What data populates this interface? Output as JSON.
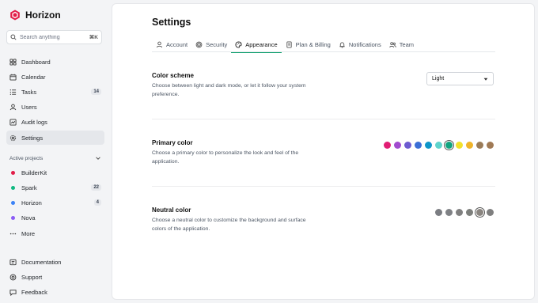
{
  "brand": {
    "name": "Horizon",
    "color": "#e11d48"
  },
  "search": {
    "placeholder": "Search anything",
    "shortcut": "⌘K"
  },
  "sidebar": {
    "items": [
      {
        "label": "Dashboard",
        "icon": "dashboard-icon"
      },
      {
        "label": "Calendar",
        "icon": "calendar-icon"
      },
      {
        "label": "Tasks",
        "icon": "tasks-icon",
        "badge": "14"
      },
      {
        "label": "Users",
        "icon": "users-icon"
      },
      {
        "label": "Audit logs",
        "icon": "audit-logs-icon"
      },
      {
        "label": "Settings",
        "icon": "gear-icon",
        "active": true
      }
    ],
    "projects_heading": "Active projects",
    "projects": [
      {
        "label": "BuilderKit",
        "color": "#e11d48"
      },
      {
        "label": "Spark",
        "color": "#10b981",
        "badge": "22"
      },
      {
        "label": "Horizon",
        "color": "#3b82f6",
        "badge": "4"
      },
      {
        "label": "Nova",
        "color": "#8b5cf6"
      },
      {
        "label": "More",
        "icon": "more-icon"
      }
    ],
    "footer": [
      {
        "label": "Documentation",
        "icon": "documentation-icon"
      },
      {
        "label": "Support",
        "icon": "support-icon"
      },
      {
        "label": "Feedback",
        "icon": "feedback-icon"
      }
    ]
  },
  "page": {
    "title": "Settings"
  },
  "tabs": [
    {
      "label": "Account",
      "icon": "user-icon"
    },
    {
      "label": "Security",
      "icon": "fingerprint-icon"
    },
    {
      "label": "Appearance",
      "icon": "palette-icon",
      "active": true
    },
    {
      "label": "Plan & Billing",
      "icon": "document-icon"
    },
    {
      "label": "Notifications",
      "icon": "bell-icon"
    },
    {
      "label": "Team",
      "icon": "team-icon"
    }
  ],
  "color_scheme": {
    "title": "Color scheme",
    "description": "Choose between light and dark mode, or let it follow your system preference.",
    "value": "Light"
  },
  "primary_color": {
    "title": "Primary color",
    "description": "Choose a primary color to personalize the look and feel of the application.",
    "swatches": [
      "#e11d74",
      "#a24bcf",
      "#6d5bd0",
      "#3b6fd6",
      "#0e96c9",
      "#5fd4cc",
      "#10a37f",
      "#f2e12b",
      "#f0b429",
      "#9a7b58",
      "#a07a55"
    ],
    "selected_index": 6
  },
  "neutral_color": {
    "title": "Neutral color",
    "description": "Choose a neutral color to customize the background and surface colors of the application.",
    "swatches": [
      "#7b7d82",
      "#7f8185",
      "#808080",
      "#7d7f7c",
      "#8a8580",
      "#7f7f7f"
    ],
    "selected_index": 4
  },
  "accent_color": "#0e9f6e"
}
